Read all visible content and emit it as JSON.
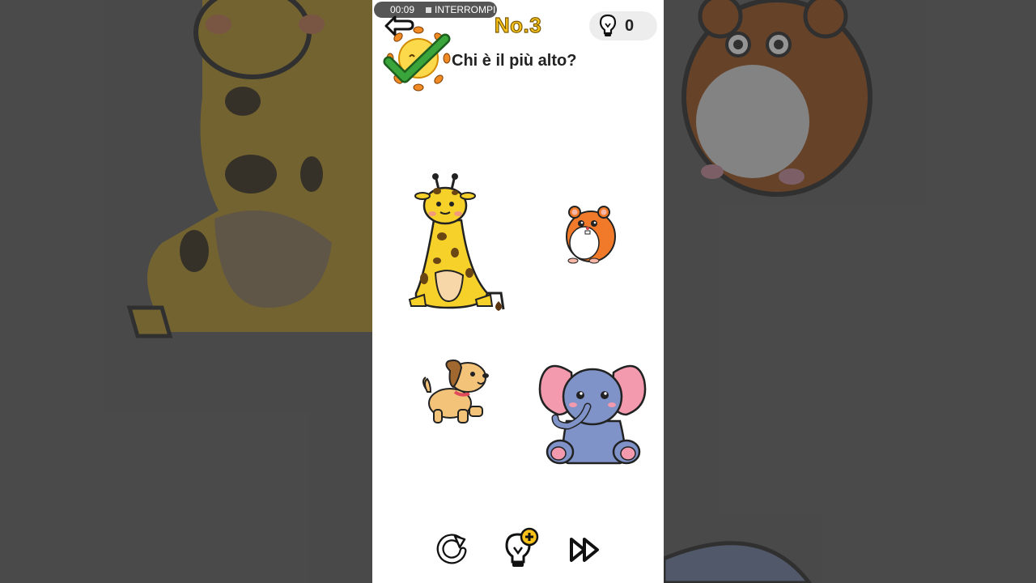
{
  "recording": {
    "time": "00:09",
    "stop_label": "INTERROMPI"
  },
  "header": {
    "level": "No.3",
    "hint_count": "0"
  },
  "puzzle": {
    "question": "Chi è il più alto?",
    "answer_state": "correct",
    "choices": [
      {
        "name": "giraffe",
        "correct": true
      },
      {
        "name": "hamster",
        "correct": false
      },
      {
        "name": "dog",
        "correct": false
      },
      {
        "name": "elephant",
        "correct": false
      }
    ]
  },
  "toolbar": {
    "buttons": [
      "restart-icon",
      "hint-plus-icon",
      "skip-icon"
    ]
  },
  "colors": {
    "title_yellow": "#f8c21a",
    "check_green": "#3aa53a",
    "sun_orange": "#f08a24",
    "giraffe_yellow": "#f6d12a",
    "hamster_orange": "#f07a2a",
    "elephant_blue": "#7f93c9",
    "dog_tan": "#f3c37a"
  }
}
